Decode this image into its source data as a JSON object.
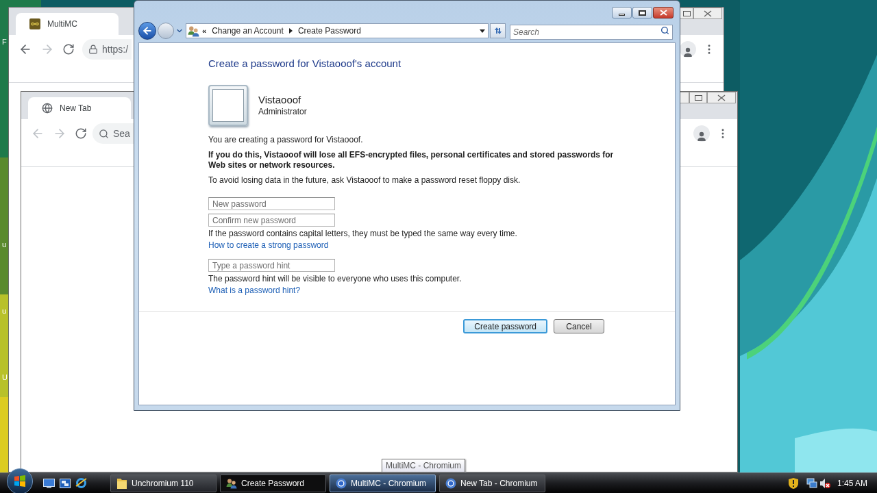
{
  "desktop": {
    "label_fragments": [
      "F",
      "u",
      "u",
      "U"
    ]
  },
  "browser_windows": [
    {
      "tab_title": "MultiMC",
      "address": "https:/",
      "back_disabled": false,
      "forward_disabled": true
    },
    {
      "tab_title": "New Tab",
      "address": "Sea",
      "back_disabled": true,
      "forward_disabled": true
    }
  ],
  "explorer": {
    "overflow_mark": "«",
    "breadcrumb": [
      "Change an Account",
      "Create Password"
    ],
    "search_placeholder": "Search",
    "heading": "Create a password for Vistaooof's account",
    "user": {
      "name": "Vistaooof",
      "role": "Administrator"
    },
    "paragraphs": [
      {
        "text": "You are creating a password for Vistaooof.",
        "bold": false
      },
      {
        "text": "If you do this, Vistaooof will lose all EFS-encrypted files, personal certificates and stored passwords for Web sites or network resources.",
        "bold": true
      },
      {
        "text": "To avoid losing data in the future, ask Vistaooof to make a password reset floppy disk.",
        "bold": false
      }
    ],
    "password_fields": [
      {
        "placeholder": "New password"
      },
      {
        "placeholder": "Confirm new password"
      }
    ],
    "password_note": "If the password contains capital letters, they must be typed the same way every time.",
    "password_link": "How to create a strong password",
    "hint_field": {
      "placeholder": "Type a password hint"
    },
    "hint_note": "The password hint will be visible to everyone who uses this computer.",
    "hint_link": "What is a password hint?",
    "buttons": [
      {
        "label": "Create password",
        "default": true
      },
      {
        "label": "Cancel",
        "default": false
      }
    ]
  },
  "tooltip": "MultiMC - Chromium",
  "taskbar": {
    "items": [
      {
        "label": "Unchromium 110",
        "selected": false,
        "hovered": false
      },
      {
        "label": "Create Password",
        "selected": true,
        "hovered": false
      },
      {
        "label": "MultiMC - Chromium",
        "selected": false,
        "hovered": true
      },
      {
        "label": "New Tab - Chromium",
        "selected": false,
        "hovered": false
      }
    ],
    "clock": "1:45 AM"
  }
}
